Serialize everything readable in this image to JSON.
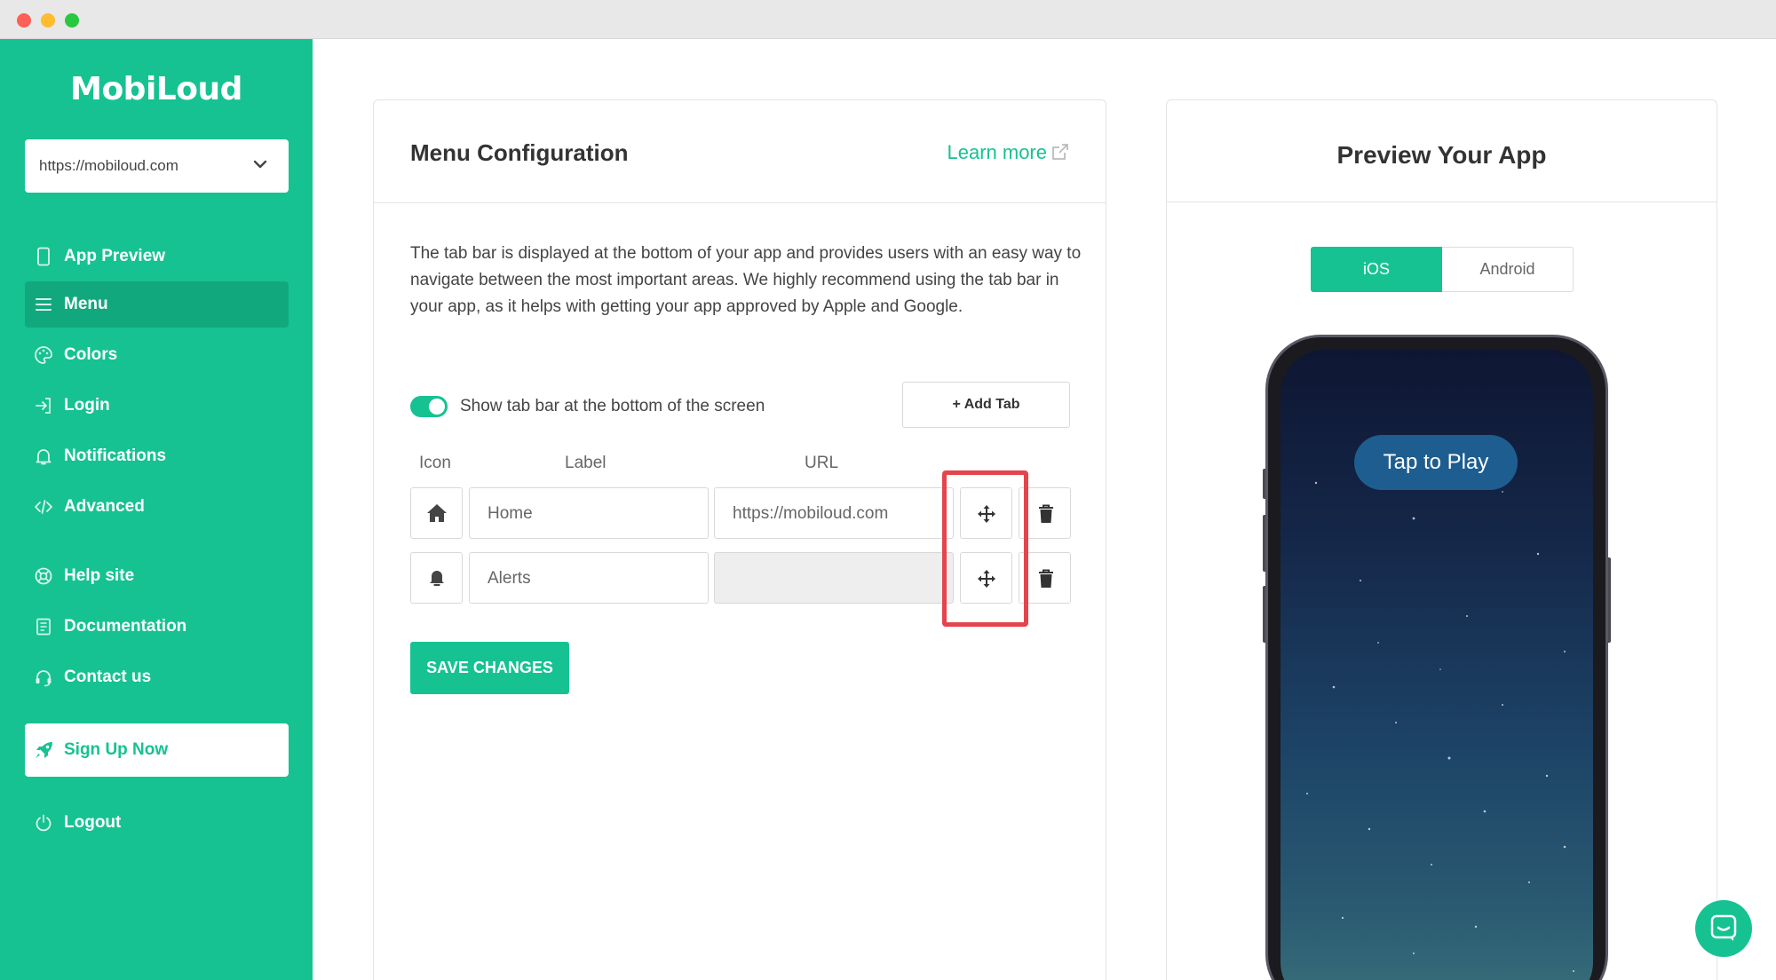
{
  "app": {
    "logo": "MobiLoud"
  },
  "site_select": {
    "value": "https://mobiloud.com"
  },
  "sidebar": {
    "items": [
      {
        "label": "App Preview",
        "icon": "phone-icon"
      },
      {
        "label": "Menu",
        "icon": "menu-icon",
        "active": true
      },
      {
        "label": "Colors",
        "icon": "palette-icon"
      },
      {
        "label": "Login",
        "icon": "login-icon"
      },
      {
        "label": "Notifications",
        "icon": "bell-icon"
      },
      {
        "label": "Advanced",
        "icon": "code-icon"
      },
      {
        "label": "Help site",
        "icon": "lifebuoy-icon"
      },
      {
        "label": "Documentation",
        "icon": "book-icon"
      },
      {
        "label": "Contact us",
        "icon": "headset-icon"
      }
    ],
    "signup": {
      "label": "Sign Up Now",
      "icon": "rocket-icon"
    },
    "logout": {
      "label": "Logout",
      "icon": "power-icon"
    }
  },
  "config": {
    "title": "Menu Configuration",
    "learn_more": "Learn more",
    "description": "The tab bar is displayed at the bottom of your app and provides users with an easy way to navigate between the most important areas. We highly recommend using the tab bar in your app, as it helps with getting your app approved by Apple and Google.",
    "toggle_label": "Show tab bar at the bottom of the screen",
    "toggle_on": true,
    "add_tab": "+ Add Tab",
    "columns": {
      "icon": "Icon",
      "label": "Label",
      "url": "URL"
    },
    "rows": [
      {
        "icon": "home-icon",
        "label": "Home",
        "url": "https://mobiloud.com"
      },
      {
        "icon": "bell-icon",
        "label": "Alerts",
        "url": ""
      }
    ],
    "save": "SAVE CHANGES"
  },
  "preview": {
    "title": "Preview Your App",
    "tabs": [
      "iOS",
      "Android"
    ],
    "selected_tab": "iOS",
    "tap_to_play": "Tap to Play"
  },
  "colors": {
    "brand": "#16c292",
    "highlight": "#e4444b"
  }
}
